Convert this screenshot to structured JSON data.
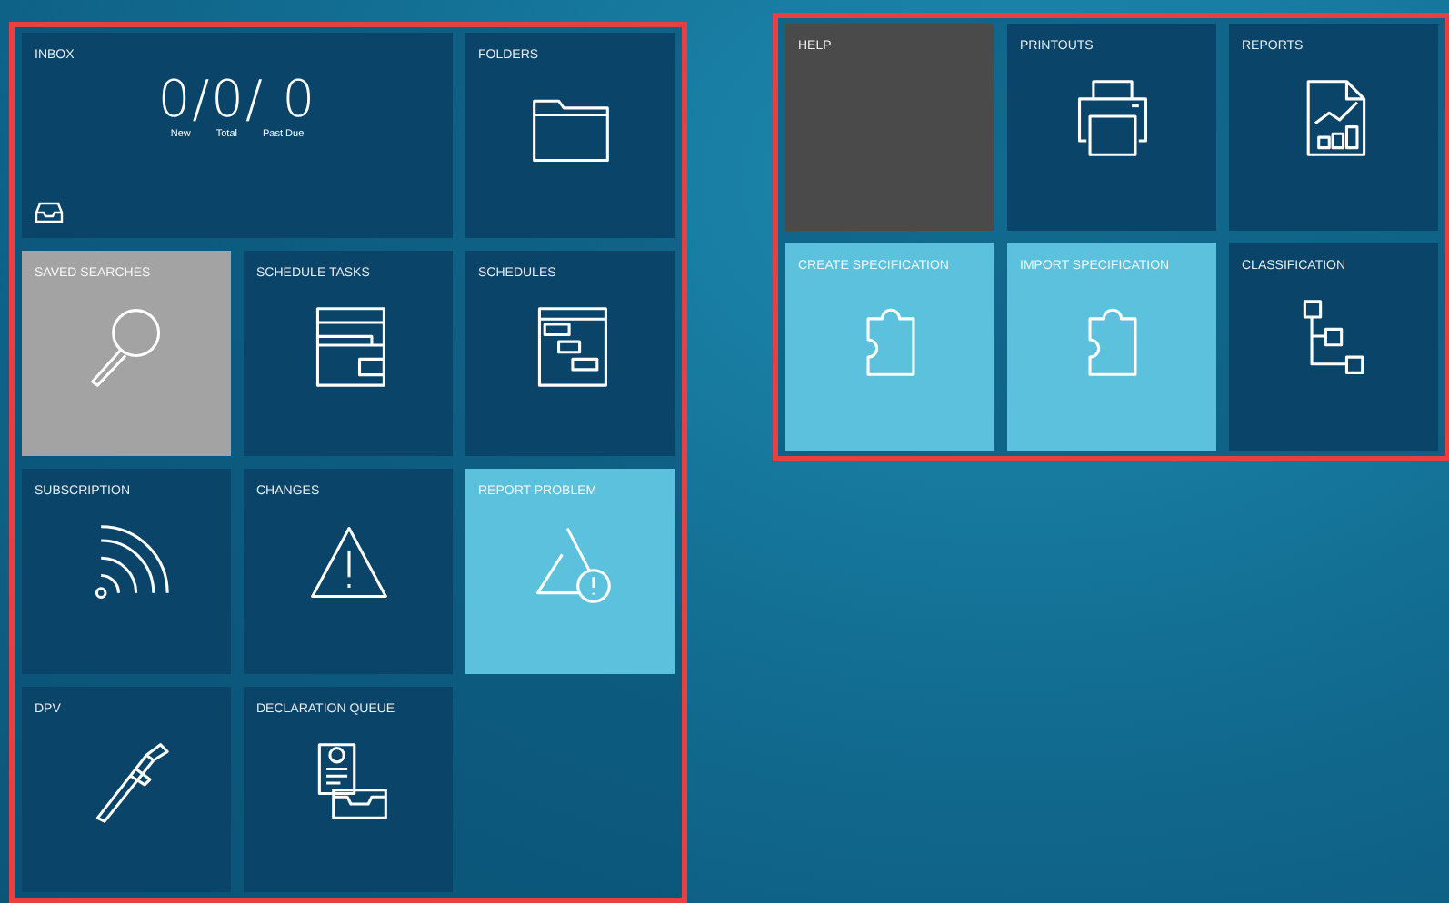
{
  "groups": [
    {
      "tiles": [
        {
          "label": "INBOX",
          "kind": "inbox",
          "color": "#0b4469",
          "wide": true,
          "counts": "0/0/ 0",
          "count_labels": [
            "New",
            "Total",
            "Past Due"
          ]
        },
        {
          "label": "FOLDERS",
          "kind": "folder",
          "color": "#0b4469",
          "wide": false
        },
        {
          "label": "SAVED SEARCHES",
          "kind": "search",
          "color": "#a3a3a3",
          "wide": false
        },
        {
          "label": "SCHEDULE TASKS",
          "kind": "window",
          "color": "#0b4469",
          "wide": false
        },
        {
          "label": "SCHEDULES",
          "kind": "gantt",
          "color": "#0b4469",
          "wide": false
        },
        {
          "label": "SUBSCRIPTION",
          "kind": "feed",
          "color": "#0b4469",
          "wide": false
        },
        {
          "label": "CHANGES",
          "kind": "warning",
          "color": "#0b4469",
          "wide": false
        },
        {
          "label": "REPORT PROBLEM",
          "kind": "problem",
          "color": "#5cc1dc",
          "wide": false
        },
        {
          "label": "DPV",
          "kind": "caliper",
          "color": "#0b4469",
          "wide": false
        },
        {
          "label": "DECLARATION QUEUE",
          "kind": "queue",
          "color": "#0b4469",
          "wide": false
        }
      ]
    },
    {
      "tiles": [
        {
          "label": "HELP",
          "kind": "blank",
          "color": "#4a4a4a",
          "wide": false
        },
        {
          "label": "PRINTOUTS",
          "kind": "printer",
          "color": "#0b4469",
          "wide": false
        },
        {
          "label": "REPORTS",
          "kind": "report",
          "color": "#0b4469",
          "wide": false
        },
        {
          "label": "CREATE SPECIFICATION",
          "kind": "puzzle",
          "color": "#5cc1dc",
          "wide": false
        },
        {
          "label": "IMPORT SPECIFICATION",
          "kind": "puzzle",
          "color": "#5cc1dc",
          "wide": false
        },
        {
          "label": "CLASSIFICATION",
          "kind": "tree",
          "color": "#0b4469",
          "wide": false
        }
      ]
    }
  ]
}
